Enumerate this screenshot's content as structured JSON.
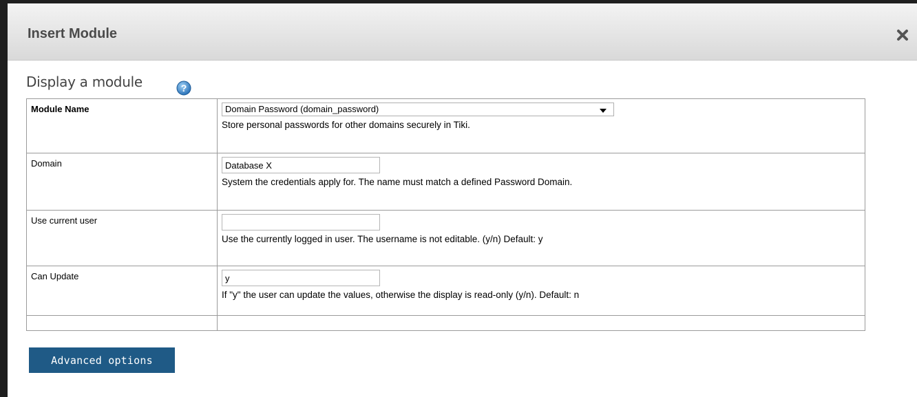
{
  "dialog": {
    "title": "Insert Module",
    "close_icon": "close-x-icon"
  },
  "section": {
    "title": "Display a module",
    "help_icon": "help-question-icon"
  },
  "params": {
    "module_name": {
      "label": "Module Name",
      "selected": "Domain Password (domain_password)",
      "description": "Store personal passwords for other domains securely in Tiki."
    },
    "domain": {
      "label": "Domain",
      "value": "Database X",
      "description": "System the credentials apply for. The name must match a defined Password Domain."
    },
    "use_current_user": {
      "label": "Use current user",
      "value": "",
      "description": "Use the currently logged in user. The username is not editable. (y/n) Default: y"
    },
    "can_update": {
      "label": "Can Update",
      "value": "y",
      "description": "If \"y\" the user can update the values, otherwise the display is read-only (y/n). Default: n"
    }
  },
  "buttons": {
    "advanced_options": "Advanced options"
  },
  "colors": {
    "button_bg": "#1f5a86",
    "titlebar_bg": "#e2e2e2",
    "backdrop": "#1e1e1e"
  }
}
